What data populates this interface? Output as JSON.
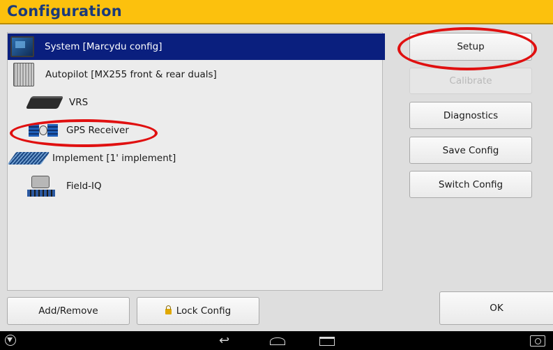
{
  "header": {
    "title": "Configuration"
  },
  "config_list": {
    "items": [
      {
        "label": "System [Marcydu config]",
        "icon": "system-display-icon",
        "selected": true
      },
      {
        "label": "Autopilot [MX255 front & rear duals]",
        "icon": "autopilot-controller-icon",
        "selected": false
      },
      {
        "label": "VRS",
        "icon": "vrs-modem-icon",
        "selected": false
      },
      {
        "label": "GPS Receiver",
        "icon": "gps-satellite-icon",
        "selected": false
      },
      {
        "label": "Implement [1' implement]",
        "icon": "implement-icon",
        "selected": false
      },
      {
        "label": "Field-IQ",
        "icon": "field-iq-icon",
        "selected": false
      }
    ]
  },
  "actions": {
    "setup": "Setup",
    "calibrate": "Calibrate",
    "diagnostics": "Diagnostics",
    "save_config": "Save Config",
    "switch_config": "Switch Config"
  },
  "bottom": {
    "add_remove": "Add/Remove",
    "lock_config": "Lock Config",
    "ok": "OK"
  },
  "annotations": {
    "color": "#e01010"
  },
  "nav_bar": {
    "icons": [
      "trimble-logo-icon",
      "back-icon",
      "home-icon",
      "recent-apps-icon",
      "screenshot-icon"
    ]
  },
  "colors": {
    "title_bar": "#fcc10d",
    "title_text": "#1b3a7a",
    "selected_row": "#0a1f7e"
  }
}
